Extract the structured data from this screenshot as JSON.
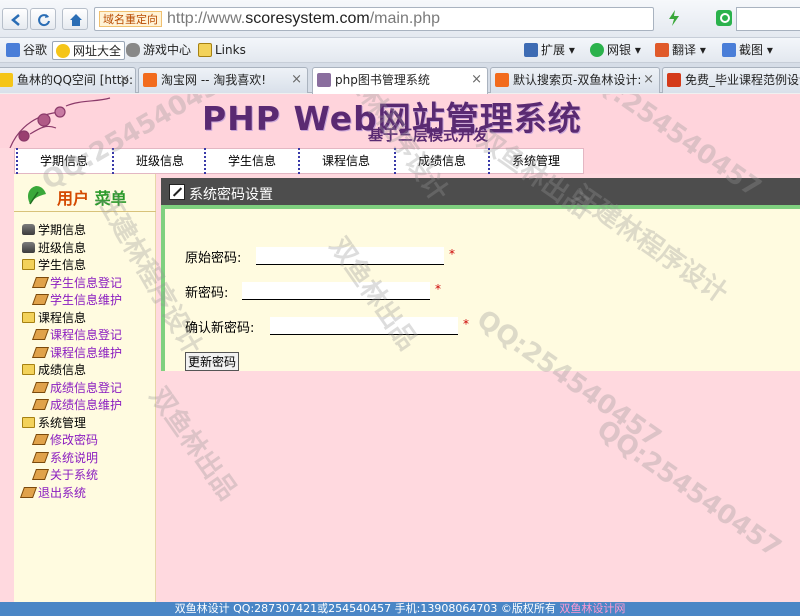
{
  "browser": {
    "url_tag": "域名重定向",
    "url_prefix": "http://www.",
    "url_domain": "scoresystem.com",
    "url_path": "/main.php",
    "search_placeholder": ""
  },
  "favorites": {
    "left": [
      {
        "label": "谷歌",
        "icon": "google-icon"
      },
      {
        "label": "网址大全",
        "icon": "star-icon"
      },
      {
        "label": "游戏中心",
        "icon": "gamepad-icon"
      },
      {
        "label": "Links",
        "icon": "folder-icon"
      }
    ],
    "right": [
      {
        "label": "扩展",
        "icon": "extension-icon"
      },
      {
        "label": "网银",
        "icon": "shield-icon"
      },
      {
        "label": "翻译",
        "icon": "translate-icon"
      },
      {
        "label": "截图",
        "icon": "scissors-icon"
      }
    ]
  },
  "tabs": [
    {
      "label": "鱼林的QQ空间 [http:",
      "icon": "qzone-icon"
    },
    {
      "label": "淘宝网 -- 淘我喜欢!",
      "icon": "taobao-icon"
    },
    {
      "label": "php图书管理系统",
      "icon": "php-icon",
      "active": true
    },
    {
      "label": "默认搜索页-双鱼林设计:",
      "icon": "taobao-icon"
    },
    {
      "label": "免费_毕业课程范例设计",
      "icon": "page-icon"
    }
  ],
  "banner": {
    "title": "PHP Web网站管理系统",
    "subtitle": "基于三层模式开发"
  },
  "topnav": [
    "学期信息",
    "班级信息",
    "学生信息",
    "课程信息",
    "成绩信息",
    "系统管理"
  ],
  "sidebar": {
    "title_a": "用户",
    "title_b": "菜单",
    "tree": [
      {
        "label": "学期信息",
        "level": 0,
        "icon": "database-icon"
      },
      {
        "label": "班级信息",
        "level": 0,
        "icon": "database-icon"
      },
      {
        "label": "学生信息",
        "level": 0,
        "icon": "folder-icon"
      },
      {
        "label": "学生信息登记",
        "level": 1,
        "icon": "book-icon"
      },
      {
        "label": "学生信息维护",
        "level": 1,
        "icon": "book-icon"
      },
      {
        "label": "课程信息",
        "level": 0,
        "icon": "folder-icon"
      },
      {
        "label": "课程信息登记",
        "level": 1,
        "icon": "book-icon"
      },
      {
        "label": "课程信息维护",
        "level": 1,
        "icon": "book-icon"
      },
      {
        "label": "成绩信息",
        "level": 0,
        "icon": "folder-icon"
      },
      {
        "label": "成绩信息登记",
        "level": 1,
        "icon": "book-icon"
      },
      {
        "label": "成绩信息维护",
        "level": 1,
        "icon": "book-icon"
      },
      {
        "label": "系统管理",
        "level": 0,
        "icon": "folder-icon"
      },
      {
        "label": "修改密码",
        "level": 1,
        "icon": "book-icon"
      },
      {
        "label": "系统说明",
        "level": 1,
        "icon": "book-icon"
      },
      {
        "label": "关于系统",
        "level": 1,
        "icon": "book-icon"
      },
      {
        "label": "退出系统",
        "level": 0,
        "icon": "book-icon"
      }
    ]
  },
  "form": {
    "title": "系统密码设置",
    "old_label": "原始密码:",
    "new_label": "新密码:",
    "confirm_label": "确认新密码:",
    "required_mark": "*",
    "submit_label": "更新密码"
  },
  "footer": {
    "text": "双鱼林设计 QQ:287307421或254540457 手机:13908064703 ©版权所有",
    "link": "双鱼林设计网"
  },
  "watermarks": [
    "QQ:254540457",
    "汪建林程序设计",
    "双鱼林出品",
    "QQ:254540457",
    "汪建林程序设计",
    "双鱼林出品",
    "QQ:254540457",
    "汪建林程序设计",
    "双鱼林出品",
    "QQ:254540457"
  ],
  "colors": {
    "page_bg": "#ffd9df",
    "sidebar_bg": "#fffbe0",
    "panel_head": "#4d4d4d",
    "accent_green": "#7fd07f",
    "footer_bg": "#4a86c6",
    "banner_text": "#5a2a72"
  }
}
